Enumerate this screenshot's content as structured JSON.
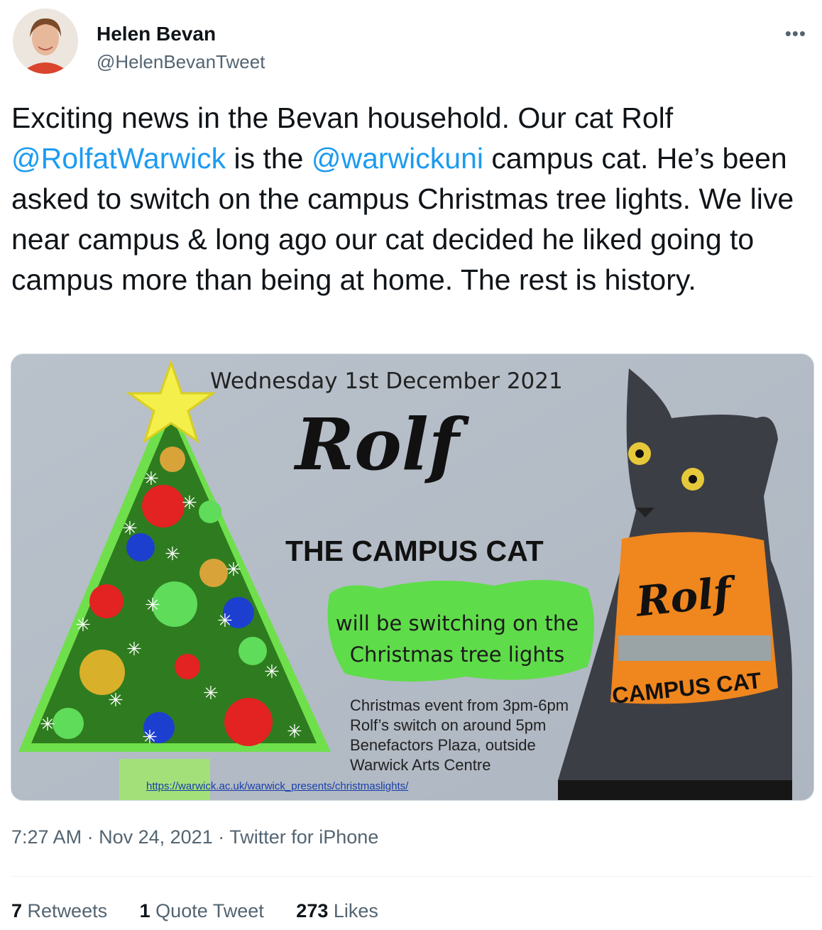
{
  "author": {
    "name": "Helen Bevan",
    "handle": "@HelenBevanTweet",
    "avatar_icon": "profile-photo",
    "more_icon": "more-dots-icon"
  },
  "tweet": {
    "text_1": "Exciting news in the Bevan household. Our cat Rolf ",
    "mention_1": "@RolfatWarwick",
    "text_2": " is the ",
    "mention_2": "@warwickuni",
    "text_3": " campus cat. He’s been asked to switch on the campus Christmas tree lights. We live near campus & long ago our cat decided he liked going to campus more than being at home. The rest is history."
  },
  "poster": {
    "date": "Wednesday 1st December 2021",
    "name": "Rolf",
    "subtitle": "THE CAMPUS CAT",
    "bubble_line1": "will be switching on the",
    "bubble_line2": "Christmas tree lights",
    "details": [
      "Christmas event from 3pm-6pm",
      "Rolf’s switch on around 5pm",
      "Benefactors Plaza, outside",
      "Warwick Arts Centre"
    ],
    "link": "https://warwick.ac.uk/warwick_presents/christmaslights/",
    "jumper_name": "Rolf",
    "jumper_text": "CAMPUS CAT"
  },
  "meta": {
    "time": "7:27 AM",
    "sep1": "·",
    "date": "Nov 24, 2021",
    "sep2": "·",
    "client": "Twitter for iPhone"
  },
  "stats": {
    "retweets_count": "7",
    "retweets_label": "Retweets",
    "quotes_count": "1",
    "quotes_label": "Quote Tweet",
    "likes_count": "273",
    "likes_label": "Likes"
  },
  "colors": {
    "link": "#1d9bf0",
    "secondary_text": "#536471",
    "poster_bg": "#b6bec8",
    "tree_green": "#2f7a1e",
    "jumper_orange": "#f0861e"
  }
}
